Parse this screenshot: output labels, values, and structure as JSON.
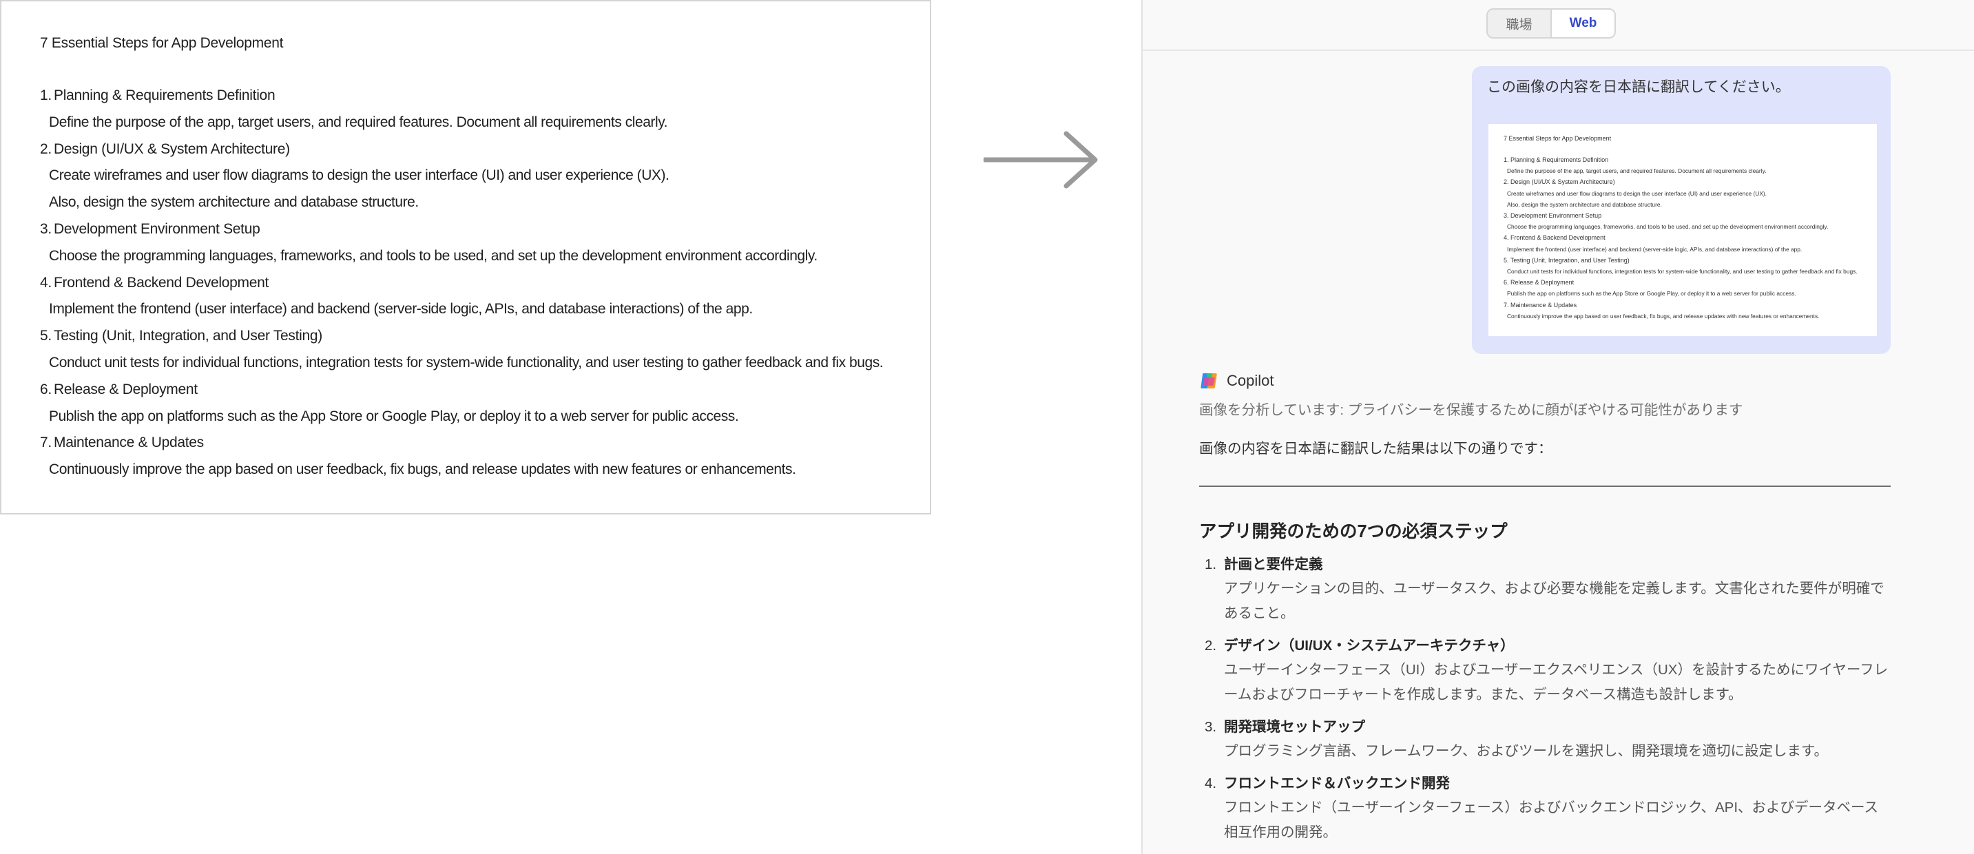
{
  "document": {
    "title": "7 Essential Steps for App Development",
    "steps": [
      {
        "num": "1.",
        "title": "Planning & Requirements Definition",
        "lines": [
          "Define the purpose of the app, target users, and required features. Document all requirements clearly."
        ]
      },
      {
        "num": "2.",
        "title": "Design (UI/UX & System Architecture)",
        "lines": [
          "Create wireframes and user flow diagrams to design the user interface (UI) and user experience (UX).",
          "Also, design the system architecture and database structure."
        ]
      },
      {
        "num": "3.",
        "title": "Development Environment Setup",
        "lines": [
          "Choose the programming languages, frameworks, and tools to be used, and set up the development environment accordingly."
        ]
      },
      {
        "num": "4.",
        "title": "Frontend & Backend Development",
        "lines": [
          "Implement the frontend (user interface) and backend (server-side logic, APIs, and database interactions) of the app."
        ]
      },
      {
        "num": "5.",
        "title": "Testing (Unit, Integration, and User Testing)",
        "lines": [
          "Conduct unit tests for individual functions, integration tests for system-wide functionality, and user testing to gather feedback and fix bugs."
        ]
      },
      {
        "num": "6.",
        "title": "Release & Deployment",
        "lines": [
          "Publish the app on platforms such as the App Store or Google Play, or deploy it to a web server for public access."
        ]
      },
      {
        "num": "7.",
        "title": "Maintenance & Updates",
        "lines": [
          "Continuously improve the app based on user feedback, fix bugs, and release updates with new features or enhancements."
        ]
      }
    ]
  },
  "toggle": {
    "work_label": "職場",
    "web_label": "Web",
    "active": "Web"
  },
  "user_message": {
    "text": "この画像の内容を日本語に翻訳してください。"
  },
  "copilot": {
    "name": "Copilot",
    "status": "画像を分析しています: プライバシーを保護するために顔がぼやける可能性があります",
    "intro": "画像の内容を日本語に翻訳した結果は以下の通りです：",
    "heading": "アプリ開発のための7つの必須ステップ",
    "items": [
      {
        "num": "1.",
        "title": "計画と要件定義",
        "desc": "アプリケーションの目的、ユーザータスク、および必要な機能を定義します。文書化された要件が明確であること。"
      },
      {
        "num": "2.",
        "title": "デザイン（UI/UX・システムアーキテクチャ）",
        "desc": "ユーザーインターフェース（UI）およびユーザーエクスペリエンス（UX）を設計するためにワイヤーフレームおよびフローチャートを作成します。また、データベース構造も設計します。"
      },
      {
        "num": "3.",
        "title": "開発環境セットアップ",
        "desc": "プログラミング言語、フレームワーク、およびツールを選択し、開発環境を適切に設定します。"
      },
      {
        "num": "4.",
        "title": "フロントエンド＆バックエンド開発",
        "desc": "フロントエンド（ユーザーインターフェース）およびバックエンドロジック、API、およびデータベース相互作用の開発。"
      }
    ]
  },
  "icons": {
    "arrow": "right-arrow-icon",
    "copilot_logo": "copilot-logo-icon"
  },
  "colors": {
    "accent": "#3447c9",
    "user_bubble": "#dfe3fb",
    "panel_bg": "#f9f9f9",
    "arrow": "#9a9a9a"
  }
}
